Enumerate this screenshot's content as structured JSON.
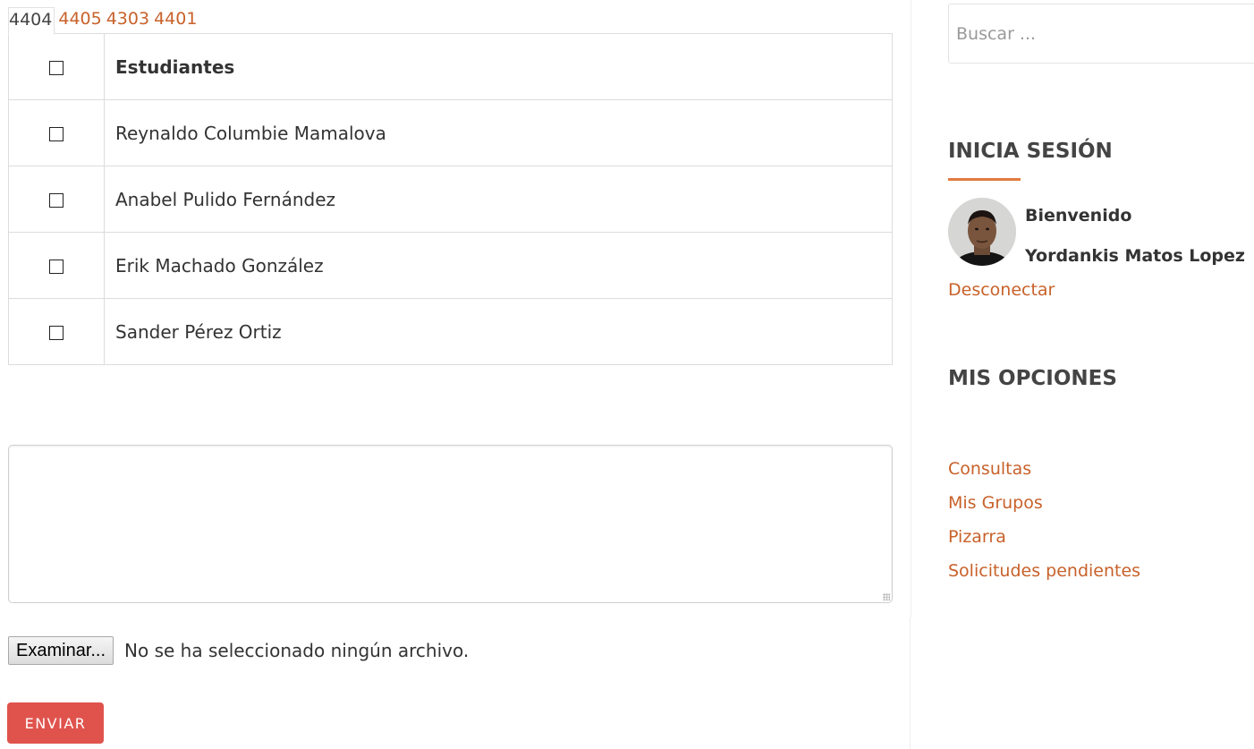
{
  "tabs": {
    "active": "4404",
    "links": [
      "4405",
      "4303",
      "4401"
    ]
  },
  "table": {
    "header": "Estudiantes",
    "rows": [
      "Reynaldo Columbie Mamalova",
      "Anabel Pulido Fernández",
      "Erik Machado González",
      "Sander Pérez Ortiz"
    ]
  },
  "message": {
    "value": ""
  },
  "file": {
    "button_label": "Examinar...",
    "status": "No se ha seleccionado ningún archivo."
  },
  "send_label": "ENVIAR",
  "sidebar": {
    "search_placeholder": "Buscar ...",
    "login_title": "INICIA SESIÓN",
    "welcome": "Bienvenido",
    "username": "Yordankis Matos Lopez",
    "logout": "Desconectar",
    "options_title": "MIS OPCIONES",
    "options": [
      "Consultas",
      "Mis Grupos",
      "Pizarra",
      "Solicitudes pendientes"
    ]
  },
  "colors": {
    "accent": "#c8612a",
    "underline": "#e27a3f",
    "send_button": "#e0534d"
  }
}
